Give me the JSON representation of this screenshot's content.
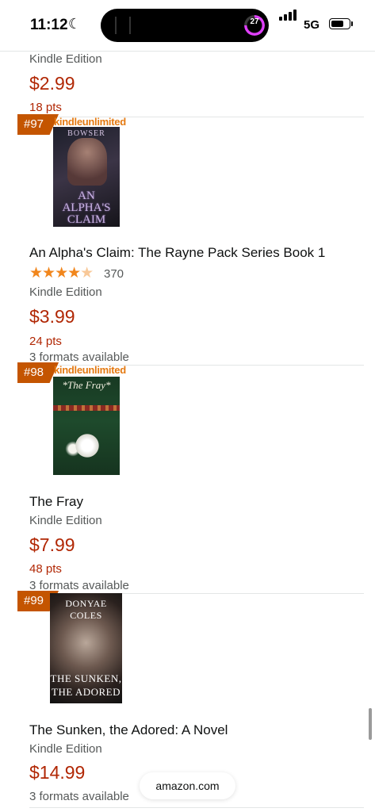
{
  "status_bar": {
    "time": "11:12",
    "focus_icon": "moon-icon",
    "island_counter": "27",
    "network": "5G",
    "battery_level": 0.75
  },
  "items": [
    {
      "edition": "Kindle Edition",
      "price": "$2.99",
      "points": "18 pts"
    },
    {
      "rank": "#97",
      "badge_label": "kindleunlimited",
      "cover_author": "BOWSER",
      "cover_title_lines": [
        "AN",
        "ALPHA'S",
        "CLAIM"
      ],
      "title": "An Alpha's Claim: The Rayne Pack Series Book 1",
      "rating": 4.5,
      "rating_count": "370",
      "edition": "Kindle Edition",
      "price": "$3.99",
      "points": "24 pts",
      "formats": "3 formats available"
    },
    {
      "rank": "#98",
      "badge_label": "kindleunlimited",
      "cover_title": "*The Fray*",
      "title": "The Fray",
      "edition": "Kindle Edition",
      "price": "$7.99",
      "points": "48 pts",
      "formats": "3 formats available"
    },
    {
      "rank": "#99",
      "cover_author": "DONYAE COLES",
      "cover_title_lines": [
        "THE SUNKEN,",
        "THE ADORED"
      ],
      "title": "The Sunken, the Adored: A Novel",
      "edition": "Kindle Edition",
      "price": "$14.99",
      "formats": "3 formats available"
    }
  ],
  "browser": {
    "url": "amazon.com"
  },
  "colors": {
    "price": "#b12704",
    "badge": "#c45500",
    "star": "#f1861c"
  }
}
